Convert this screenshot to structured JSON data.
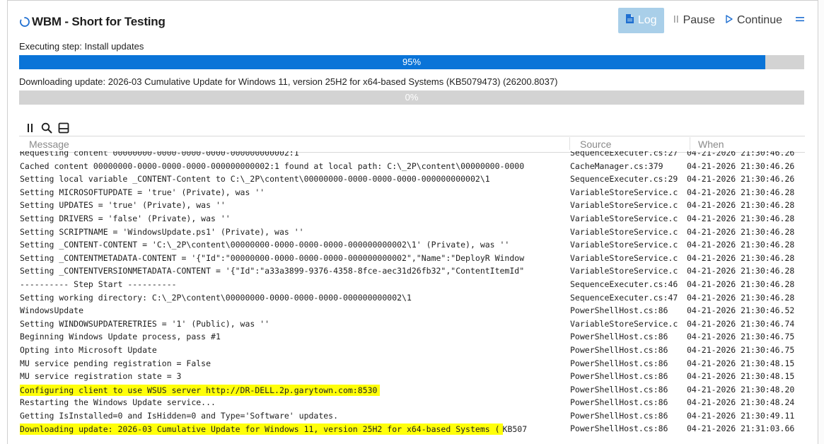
{
  "window": {
    "title": "WBM - Short for Testing",
    "buttons": {
      "log": "Log",
      "pause": "Pause",
      "continue": "Continue"
    }
  },
  "status": {
    "step_text": "Executing step: Install updates",
    "overall_progress": {
      "value": 95,
      "label": "95%"
    },
    "download_text": "Downloading update: 2026-03 Cumulative Update for Windows 11, version 25H2 for x64-based Systems (KB5079473) (26200.8037)",
    "download_progress": {
      "value": 0,
      "label": "0%"
    }
  },
  "log": {
    "columns": [
      "Message",
      "Source",
      "When"
    ],
    "rows": [
      {
        "message": "Requesting content 00000000-0000-0000-0000-000000000002:1",
        "source": "SequenceExecuter.cs:27",
        "when": "04-21-2026 21:30:46.26",
        "highlight": false
      },
      {
        "message": "Cached content 00000000-0000-0000-0000-000000000002:1 found at local path: C:\\_2P\\content\\00000000-0000",
        "source": "CacheManager.cs:379",
        "when": "04-21-2026 21:30:46.26",
        "highlight": false
      },
      {
        "message": "Setting local variable _CONTENT-Content to C:\\_2P\\content\\00000000-0000-0000-0000-000000000002\\1",
        "source": "SequenceExecuter.cs:29",
        "when": "04-21-2026 21:30:46.26",
        "highlight": false
      },
      {
        "message": "Setting MICROSOFTUPDATE = 'true' (Private), was ''",
        "source": "VariableStoreService.c",
        "when": "04-21-2026 21:30:46.28",
        "highlight": false
      },
      {
        "message": "Setting UPDATES = 'true' (Private), was ''",
        "source": "VariableStoreService.c",
        "when": "04-21-2026 21:30:46.28",
        "highlight": false
      },
      {
        "message": "Setting DRIVERS = 'false' (Private), was ''",
        "source": "VariableStoreService.c",
        "when": "04-21-2026 21:30:46.28",
        "highlight": false
      },
      {
        "message": "Setting SCRIPTNAME = 'WindowsUpdate.ps1' (Private), was ''",
        "source": "VariableStoreService.c",
        "when": "04-21-2026 21:30:46.28",
        "highlight": false
      },
      {
        "message": "Setting _CONTENT-CONTENT = 'C:\\_2P\\content\\00000000-0000-0000-0000-000000000002\\1' (Private), was ''",
        "source": "VariableStoreService.c",
        "when": "04-21-2026 21:30:46.28",
        "highlight": false
      },
      {
        "message": "Setting _CONTENTMETADATA-CONTENT = '{\"Id\":\"00000000-0000-0000-0000-000000000002\",\"Name\":\"DeployR Window",
        "source": "VariableStoreService.c",
        "when": "04-21-2026 21:30:46.28",
        "highlight": false
      },
      {
        "message": "Setting _CONTENTVERSIONMETADATA-CONTENT = '{\"Id\":\"a33a3899-9376-4358-8fce-aec31d26fb32\",\"ContentItemId\"",
        "source": "VariableStoreService.c",
        "when": "04-21-2026 21:30:46.28",
        "highlight": false
      },
      {
        "message": "---------- Step Start ----------",
        "source": "SequenceExecuter.cs:46",
        "when": "04-21-2026 21:30:46.28",
        "highlight": false
      },
      {
        "message": "Setting working directory: C:\\_2P\\content\\00000000-0000-0000-0000-000000000002\\1",
        "source": "SequenceExecuter.cs:47",
        "when": "04-21-2026 21:30:46.28",
        "highlight": false
      },
      {
        "message": "WindowsUpdate",
        "source": "PowerShellHost.cs:86",
        "when": "04-21-2026 21:30:46.52",
        "highlight": false
      },
      {
        "message": "Setting WINDOWSUPDATERETRIES = '1' (Public), was ''",
        "source": "VariableStoreService.c",
        "when": "04-21-2026 21:30:46.74",
        "highlight": false
      },
      {
        "message": "Beginning Windows Update process, pass #1",
        "source": "PowerShellHost.cs:86",
        "when": "04-21-2026 21:30:46.75",
        "highlight": false
      },
      {
        "message": "Opting into Microsoft Update",
        "source": "PowerShellHost.cs:86",
        "when": "04-21-2026 21:30:46.75",
        "highlight": false
      },
      {
        "message": "MU service pending registration = False",
        "source": "PowerShellHost.cs:86",
        "when": "04-21-2026 21:30:48.15",
        "highlight": false
      },
      {
        "message": "MU service registration state = 3",
        "source": "PowerShellHost.cs:86",
        "when": "04-21-2026 21:30:48.15",
        "highlight": false
      },
      {
        "message": "Configuring client to use WSUS server  http://DR-DELL.2p.garytown.com:8530",
        "source": "PowerShellHost.cs:86",
        "when": "04-21-2026 21:30:48.20",
        "highlight": true
      },
      {
        "message": "Restarting the Windows Update service...",
        "source": "PowerShellHost.cs:86",
        "when": "04-21-2026 21:30:48.24",
        "highlight": false
      },
      {
        "message": "Getting IsInstalled=0 and IsHidden=0 and Type='Software' updates.",
        "source": "PowerShellHost.cs:86",
        "when": "04-21-2026 21:30:49.11",
        "highlight": false
      },
      {
        "message": "Downloading update: 2026-03 Cumulative Update for Windows 11, version 25H2 for x64-based Systems (",
        "message_tail": "KB507",
        "source": "PowerShellHost.cs:86",
        "when": "04-21-2026 21:31:03.66",
        "highlight": true
      }
    ]
  },
  "colors": {
    "accent": "#0a74d8",
    "log_button_bg": "#a9cfe9",
    "highlight": "#ffff0a",
    "progress_track": "#d3d3d3"
  },
  "icons": {
    "title": "spinner-icon",
    "log": "document-icon",
    "pause": "pause-icon",
    "continue": "play-icon",
    "menu": "menu-icon",
    "toolbar": [
      "pause-icon",
      "search-icon",
      "panel-icon"
    ]
  }
}
